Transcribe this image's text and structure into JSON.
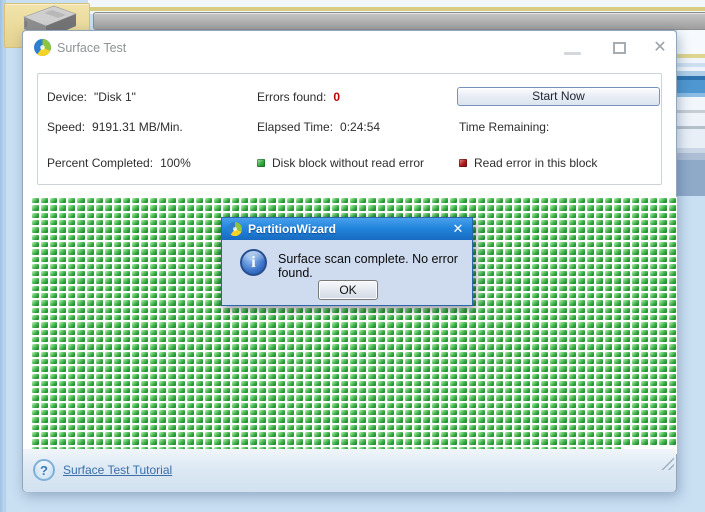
{
  "surface_test": {
    "title": "Surface Test",
    "controls": {
      "close_icon": "✕"
    },
    "info": {
      "device_label": "Device:",
      "device_value": "\"Disk 1\"",
      "errors_label": "Errors found:",
      "errors_value": "0",
      "start_button": "Start Now",
      "speed_label": "Speed:",
      "speed_value": "9191.31 MB/Min.",
      "elapsed_label": "Elapsed Time:",
      "elapsed_value": "0:24:54",
      "remaining_label": "Time Remaining:",
      "remaining_value": "",
      "percent_label": "Percent Completed:",
      "percent_value": "100%",
      "legend_ok": "Disk block without read error",
      "legend_error": "Read error in this block"
    },
    "footer": {
      "tutorial_link": "Surface Test Tutorial",
      "help_icon": "?"
    }
  },
  "dialog": {
    "title": "PartitionWizard",
    "message": "Surface scan complete. No error found.",
    "ok_button": "OK",
    "close_icon": "✕",
    "info_icon": "i"
  },
  "grid": {
    "columns": 71,
    "rows": 35,
    "last_row_cells": 65
  },
  "colors": {
    "ok_block": "#35a742",
    "error_block": "#b21b1b",
    "errors_value_text": "#c00000",
    "dialog_titlebar": "#2285dd",
    "link": "#3a6fa8"
  }
}
